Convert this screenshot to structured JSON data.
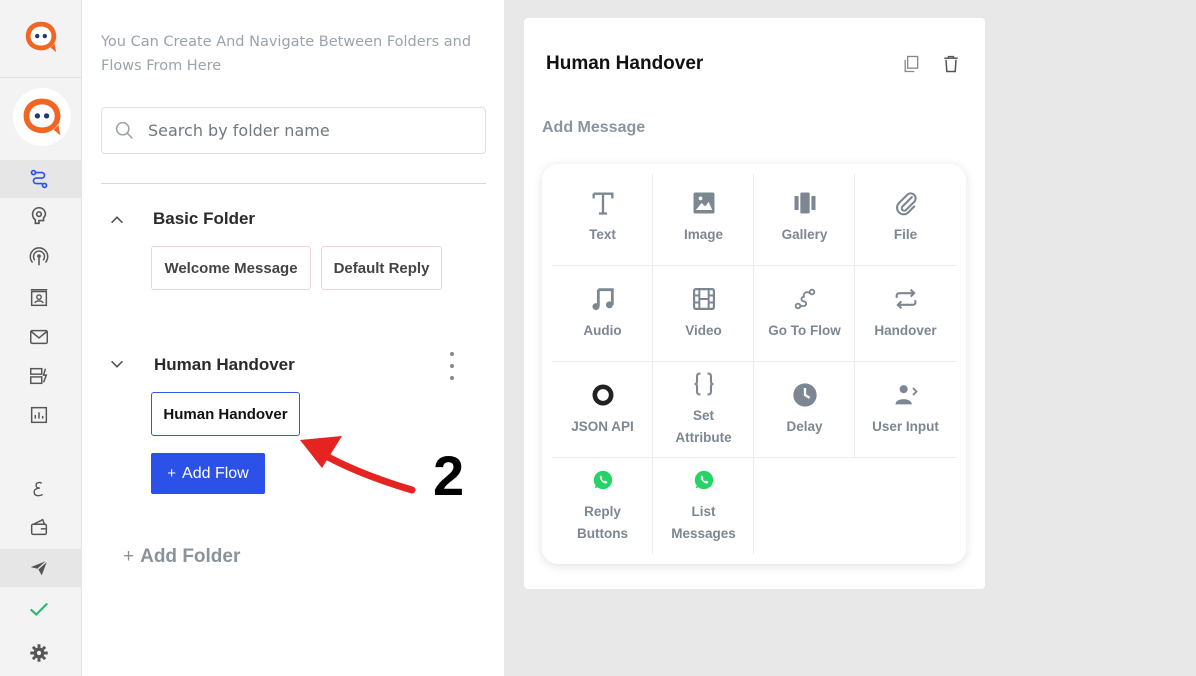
{
  "panel": {
    "hint": "You Can Create And Navigate Between Folders and Flows From Here",
    "search_placeholder": "Search by folder name",
    "folders": [
      {
        "name": "Basic Folder",
        "expanded": true,
        "flows": [
          "Welcome Message",
          "Default Reply"
        ]
      },
      {
        "name": "Human Handover",
        "expanded": false,
        "flows": [
          "Human Handover"
        ]
      }
    ],
    "add_flow_label": "Add Flow",
    "add_folder_label": "Add Folder"
  },
  "annotation": {
    "step": "2",
    "color": "#e52421"
  },
  "editor": {
    "title": "Human Handover",
    "add_message_label": "Add Message",
    "message_types": [
      {
        "label": "Text",
        "icon": "text-icon"
      },
      {
        "label": "Image",
        "icon": "image-icon"
      },
      {
        "label": "Gallery",
        "icon": "gallery-icon"
      },
      {
        "label": "File",
        "icon": "paperclip-icon"
      },
      {
        "label": "Audio",
        "icon": "music-note-icon"
      },
      {
        "label": "Video",
        "icon": "film-icon"
      },
      {
        "label": "Go To Flow",
        "icon": "route-icon"
      },
      {
        "label": "Handover",
        "icon": "repeat-icon"
      },
      {
        "label": "JSON API",
        "icon": "json-icon"
      },
      {
        "label": "Set Attribute",
        "icon": "braces-icon"
      },
      {
        "label": "Delay",
        "icon": "clock-icon"
      },
      {
        "label": "User Input",
        "icon": "user-input-icon"
      },
      {
        "label": "Reply Buttons",
        "icon": "whatsapp-icon"
      },
      {
        "label": "List Messages",
        "icon": "whatsapp-icon"
      }
    ]
  },
  "colors": {
    "brand_orange": "#f26522",
    "brand_navy": "#1e3a6e",
    "primary_blue": "#2b51e8",
    "icon_gray": "#7d8792",
    "whatsapp_green": "#25d366",
    "check_green": "#2eb872"
  }
}
